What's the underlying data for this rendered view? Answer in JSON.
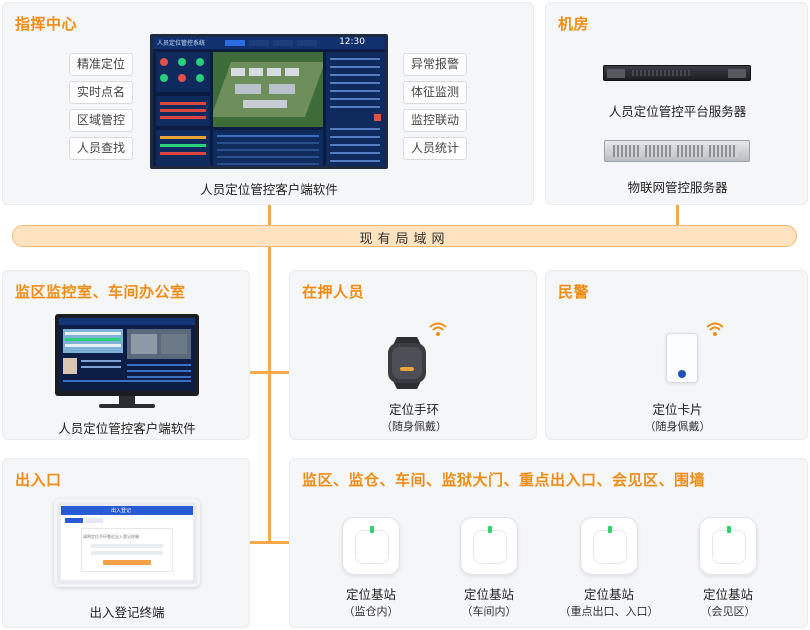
{
  "network": {
    "lan_label": "现有局域网"
  },
  "command_center": {
    "title": "指挥中心",
    "left_tags": [
      "精准定位",
      "实时点名",
      "区域管控",
      "人员查找"
    ],
    "right_tags": [
      "异常报警",
      "体征监测",
      "监控联动",
      "人员统计"
    ],
    "screen_title": "人员定位管控系统",
    "screen_clock": "12:30",
    "caption": "人员定位管控客户端软件"
  },
  "machine_room": {
    "title": "机房",
    "server1_caption": "人员定位管控平台服务器",
    "server2_caption": "物联网管控服务器"
  },
  "monitor_room": {
    "title": "监区监控室、车间办公室",
    "caption": "人员定位管控客户端软件"
  },
  "detainee": {
    "title": "在押人员",
    "device": "定位手环",
    "note": "（随身佩戴）"
  },
  "police": {
    "title": "民警",
    "device": "定位卡片",
    "note": "（随身佩戴）"
  },
  "entrance": {
    "title": "出入口",
    "terminal_header": "出入登记",
    "terminal_title": "请将定位手环靠近出入登记终端",
    "caption": "出入登记终端"
  },
  "zones": {
    "title": "监区、监仓、车间、监狱大门、重点出入口、会见区、围墙",
    "stations": [
      {
        "label": "定位基站",
        "note": "（监仓内）"
      },
      {
        "label": "定位基站",
        "note": "（车间内）"
      },
      {
        "label": "定位基站",
        "note": "（重点出口、入口）"
      },
      {
        "label": "定位基站",
        "note": "（会见区）"
      }
    ]
  },
  "colors": {
    "accent": "#f08c14",
    "line": "#f5a94a",
    "lan_fill": "#fde3bf"
  }
}
